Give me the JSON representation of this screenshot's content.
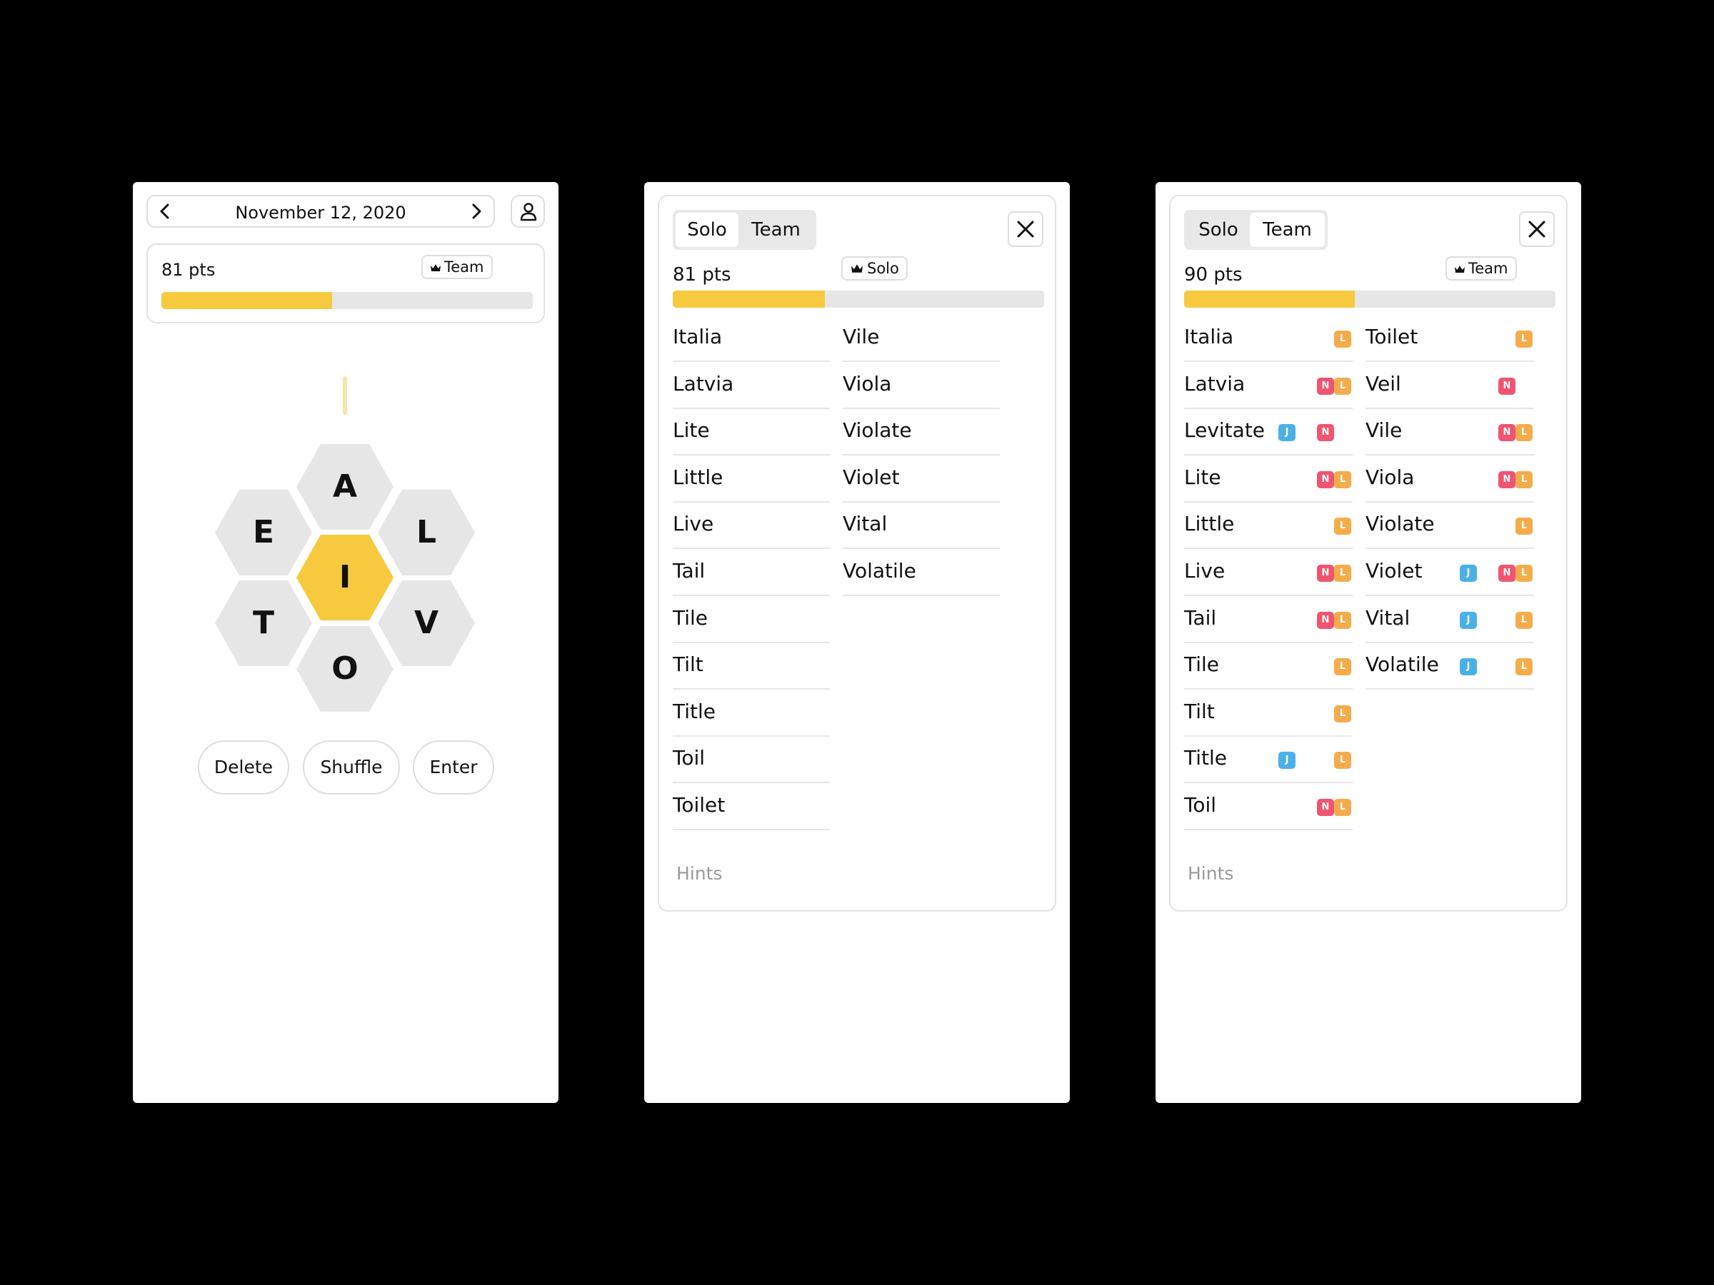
{
  "screen1": {
    "date": "November 12, 2020",
    "score": {
      "points": "81 pts",
      "badge": "Team",
      "progress": 0.46
    },
    "letters": {
      "center": "I",
      "outer": [
        "A",
        "L",
        "V",
        "O",
        "T",
        "E"
      ]
    },
    "buttons": {
      "delete": "Delete",
      "shuffle": "Shuffle",
      "enter": "Enter"
    }
  },
  "screen2": {
    "tabs": {
      "solo": "Solo",
      "team": "Team",
      "active": "team"
    },
    "score": {
      "points": "81 pts",
      "badge": "Solo",
      "progress": 0.41
    },
    "words_col1": [
      "Italia",
      "Latvia",
      "Lite",
      "Little",
      "Live",
      "Tail",
      "Tile",
      "Tilt",
      "Title",
      "Toil",
      "Toilet"
    ],
    "words_col2": [
      "Vile",
      "Viola",
      "Violate",
      "Violet",
      "Vital",
      "Volatile"
    ],
    "hints": "Hints"
  },
  "screen3": {
    "tabs": {
      "solo": "Solo",
      "team": "Team",
      "active": "solo"
    },
    "score": {
      "points": "90 pts",
      "badge": "Team",
      "progress": 0.46
    },
    "words_col1": [
      {
        "word": "Italia",
        "chips": [
          "",
          "",
          "L"
        ]
      },
      {
        "word": "Latvia",
        "chips": [
          "",
          "N",
          "L"
        ]
      },
      {
        "word": "Levitate",
        "chips": [
          "J",
          "N",
          ""
        ]
      },
      {
        "word": "Lite",
        "chips": [
          "",
          "N",
          "L"
        ]
      },
      {
        "word": "Little",
        "chips": [
          "",
          "",
          "L"
        ]
      },
      {
        "word": "Live",
        "chips": [
          "",
          "N",
          "L"
        ]
      },
      {
        "word": "Tail",
        "chips": [
          "",
          "N",
          "L"
        ]
      },
      {
        "word": "Tile",
        "chips": [
          "",
          "",
          "L"
        ]
      },
      {
        "word": "Tilt",
        "chips": [
          "",
          "",
          "L"
        ]
      },
      {
        "word": "Title",
        "chips": [
          "J",
          "",
          "L"
        ]
      },
      {
        "word": "Toil",
        "chips": [
          "",
          "N",
          "L"
        ]
      }
    ],
    "words_col2": [
      {
        "word": "Toilet",
        "chips": [
          "",
          "",
          "L"
        ]
      },
      {
        "word": "Veil",
        "chips": [
          "",
          "N",
          ""
        ]
      },
      {
        "word": "Vile",
        "chips": [
          "",
          "N",
          "L"
        ]
      },
      {
        "word": "Viola",
        "chips": [
          "",
          "N",
          "L"
        ]
      },
      {
        "word": "Violate",
        "chips": [
          "",
          "",
          "L"
        ]
      },
      {
        "word": "Violet",
        "chips": [
          "J",
          "N",
          "L"
        ]
      },
      {
        "word": "Vital",
        "chips": [
          "J",
          "",
          "L"
        ]
      },
      {
        "word": "Volatile",
        "chips": [
          "J",
          "",
          "L"
        ]
      }
    ],
    "hints": "Hints"
  },
  "colors": {
    "accent": "#f7c93e",
    "hex_gray": "#e6e6e6",
    "chip_j": "#4ab1e6",
    "chip_n": "#ef5471",
    "chip_l": "#f4ac4b"
  }
}
